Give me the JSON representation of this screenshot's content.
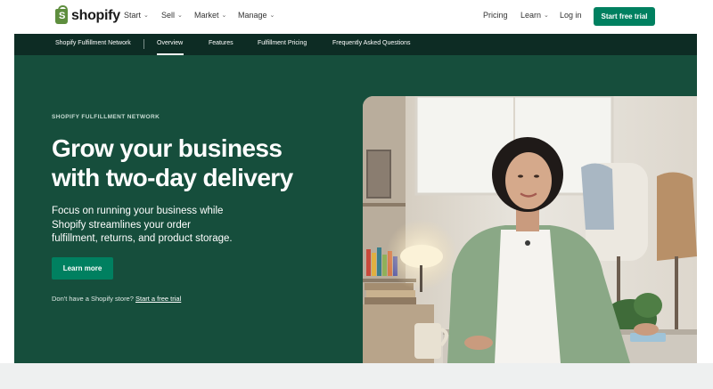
{
  "nav": {
    "brand": "shopify",
    "logo_letter": "S",
    "menu": [
      {
        "label": "Start"
      },
      {
        "label": "Sell"
      },
      {
        "label": "Market"
      },
      {
        "label": "Manage"
      }
    ],
    "pricing": "Pricing",
    "learn": "Learn",
    "login": "Log in",
    "cta": "Start free trial",
    "chevron": "⌄"
  },
  "subnav": {
    "items": [
      {
        "label": "Shopify Fulfillment Network"
      },
      {
        "label": "Overview"
      },
      {
        "label": "Features"
      },
      {
        "label": "Fulfillment Pricing"
      },
      {
        "label": "Frequently Asked Questions"
      }
    ],
    "active_item": "Overview"
  },
  "hero": {
    "eyebrow": "SHOPIFY FULFILLMENT NETWORK",
    "headline_line1": "Grow your business",
    "headline_line2": "with two-day delivery",
    "sub_line1": "Focus on running your business while",
    "sub_line2": "Shopify streamlines your order",
    "sub_line3": "fulfillment, returns, and product storage.",
    "button": "Learn more",
    "no_store_text": "Don't have a Shopify store?",
    "no_store_link": "Start a free trial"
  },
  "colors": {
    "brand_green": "#008060",
    "hero_bg": "#164e3c",
    "subnav_bg": "#0d2c24",
    "logo_green": "#5e8e3e"
  }
}
